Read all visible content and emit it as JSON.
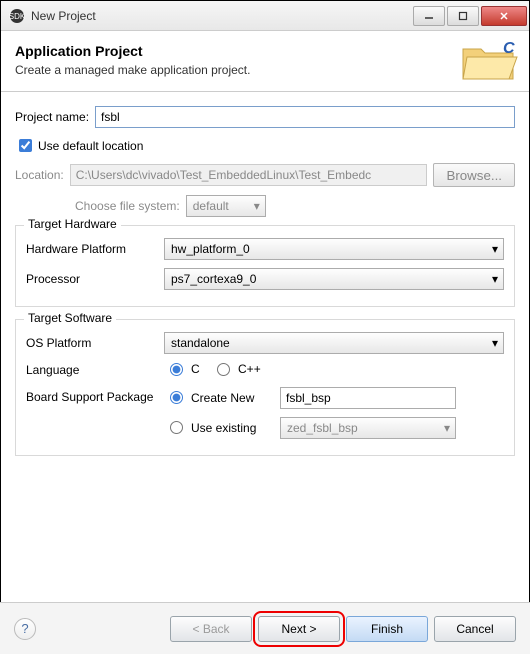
{
  "window": {
    "title": "New Project"
  },
  "banner": {
    "heading": "Application Project",
    "subtitle": "Create a managed make application project."
  },
  "form": {
    "project_name_label": "Project name:",
    "project_name_value": "fsbl",
    "use_default_label": "Use default location",
    "location_label": "Location:",
    "location_value": "C:\\Users\\dc\\vivado\\Test_EmbeddedLinux\\Test_Embedc",
    "browse_label": "Browse...",
    "choose_fs_label": "Choose file system:",
    "choose_fs_value": "default"
  },
  "hw": {
    "legend": "Target Hardware",
    "platform_label": "Hardware Platform",
    "platform_value": "hw_platform_0",
    "processor_label": "Processor",
    "processor_value": "ps7_cortexa9_0"
  },
  "sw": {
    "legend": "Target Software",
    "os_label": "OS Platform",
    "os_value": "standalone",
    "lang_label": "Language",
    "lang_c": "C",
    "lang_cpp": "C++",
    "bsp_label": "Board Support Package",
    "bsp_create": "Create New",
    "bsp_create_value": "fsbl_bsp",
    "bsp_existing": "Use existing",
    "bsp_existing_value": "zed_fsbl_bsp"
  },
  "footer": {
    "back": "< Back",
    "next": "Next >",
    "finish": "Finish",
    "cancel": "Cancel",
    "help": "?"
  }
}
